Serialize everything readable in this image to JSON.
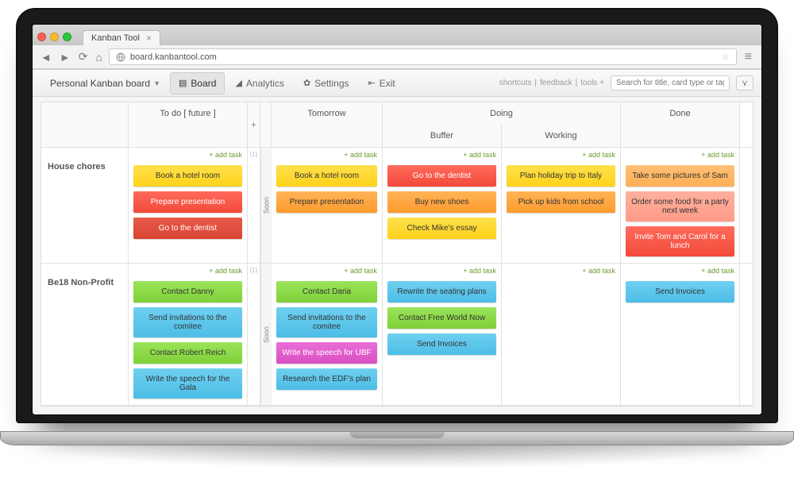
{
  "browser": {
    "tab_title": "Kanban Tool",
    "url": "board.kanbantool.com"
  },
  "toolbar": {
    "board_name": "Personal Kanban board",
    "nav": {
      "board": "Board",
      "analytics": "Analytics",
      "settings": "Settings",
      "exit": "Exit"
    },
    "links": {
      "shortcuts": "shortcuts",
      "feedback": "feedback",
      "tools": "tools +"
    },
    "search_placeholder": "Search for title, card type or tag...",
    "filter_glyph": "⋎"
  },
  "columns": {
    "todo": "To do [ future ]",
    "plus": "+",
    "soon": "Soon",
    "tomorrow": "Tomorrow",
    "doing": "Doing",
    "buffer": "Buffer",
    "working": "Working",
    "done": "Done"
  },
  "add_task_label": "add task",
  "swimlanes": [
    {
      "name": "House chores",
      "todo": [
        {
          "text": "Book a hotel room",
          "color": "yellow"
        },
        {
          "text": "Prepare presentation",
          "color": "red"
        },
        {
          "text": "Go to the dentist",
          "color": "red-dark"
        }
      ],
      "narrow_label": "(1)",
      "tomorrow": [
        {
          "text": "Book a hotel room",
          "color": "yellow"
        },
        {
          "text": "Prepare presentation",
          "color": "orange"
        }
      ],
      "buffer": [
        {
          "text": "Go to the dentist",
          "color": "red"
        },
        {
          "text": "Buy new shoes",
          "color": "orange"
        },
        {
          "text": "Check Mike's essay",
          "color": "yellow"
        }
      ],
      "working": [
        {
          "text": "Plan holiday trip to Italy",
          "color": "yellow"
        },
        {
          "text": "Pick up kids from school",
          "color": "orange"
        }
      ],
      "done": [
        {
          "text": "Take some pictures of Sam",
          "color": "orange-light"
        },
        {
          "text": "Order some food for a party next week",
          "color": "salmon"
        },
        {
          "text": "Invite Tom and Carol for a lunch",
          "color": "red"
        }
      ]
    },
    {
      "name": "Be18 Non-Profit",
      "todo": [
        {
          "text": "Contact Danny",
          "color": "green"
        },
        {
          "text": "Send invitations to the comitee",
          "color": "blue"
        },
        {
          "text": "Contact Robert Reich",
          "color": "green"
        },
        {
          "text": "Write the speech for the Gala",
          "color": "blue"
        }
      ],
      "narrow_label": "(1)",
      "tomorrow": [
        {
          "text": "Contact Daria",
          "color": "green"
        },
        {
          "text": "Send invitations to the comitee",
          "color": "blue"
        },
        {
          "text": "Write the speech for UBF",
          "color": "magenta"
        },
        {
          "text": "Research the EDF's plan",
          "color": "blue"
        }
      ],
      "buffer": [
        {
          "text": "Rewrite the seating plans",
          "color": "blue"
        },
        {
          "text": "Contact Free World Now",
          "color": "green"
        },
        {
          "text": "Send Invoices",
          "color": "blue"
        }
      ],
      "working": [],
      "done": [
        {
          "text": "Send Invoices",
          "color": "blue"
        }
      ]
    }
  ]
}
